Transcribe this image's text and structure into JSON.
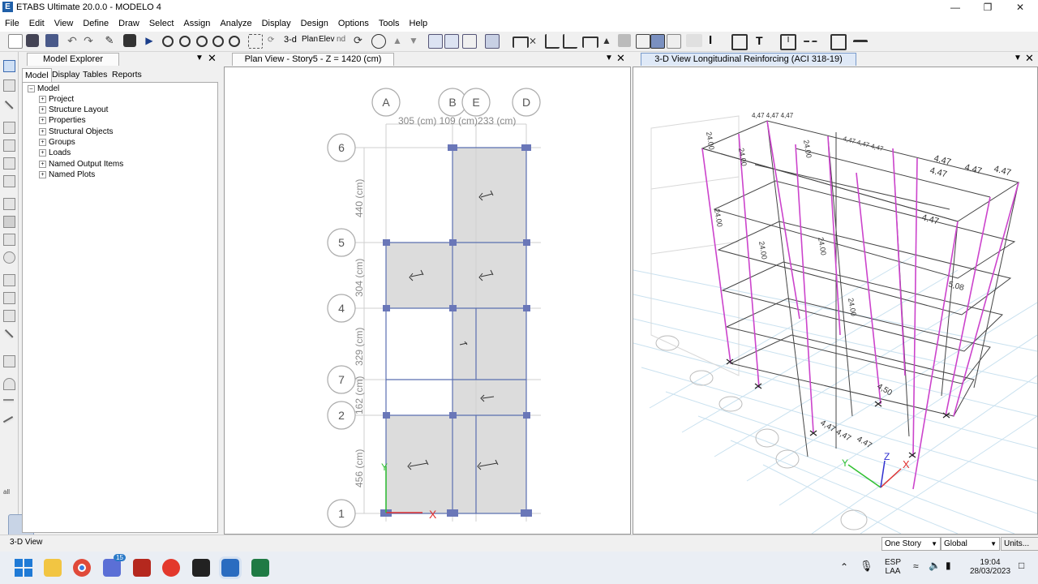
{
  "window": {
    "title": "ETABS Ultimate 20.0.0 - MODELO 4",
    "app_letter": "E"
  },
  "menu": [
    "File",
    "Edit",
    "View",
    "Define",
    "Draw",
    "Select",
    "Assign",
    "Analyze",
    "Display",
    "Design",
    "Options",
    "Tools",
    "Help"
  ],
  "toolbar": {
    "view_3d": "3-d",
    "plan": "Plan",
    "elevation": "Elev",
    "nd": "nd"
  },
  "model_explorer": {
    "title": "Model Explorer",
    "tabs": [
      "Model",
      "Display",
      "Tables",
      "Reports"
    ],
    "root": "Model",
    "items": [
      "Project",
      "Structure Layout",
      "Properties",
      "Structural Objects",
      "Groups",
      "Loads",
      "Named Output Items",
      "Named Plots"
    ]
  },
  "plan_view": {
    "title": "Plan View - Story5 - Z = 1420 (cm)",
    "grid_x": [
      "A",
      "B",
      "E",
      "D"
    ],
    "grid_y": [
      "6",
      "5",
      "4",
      "7",
      "2",
      "1"
    ],
    "dim_x": "305 (cm) 109 (cm)233 (cm)",
    "dim_y": [
      "440 (cm)",
      "304 (cm)",
      "329 (cm)",
      "162 (cm)",
      "456 (cm)"
    ],
    "axis_x": "X",
    "axis_y": "Y"
  },
  "view3d": {
    "title": "3-D View  Longitudinal Reinforcing  (ACI 318-19)",
    "rebar_label": "4.47",
    "column_label": "24.00",
    "beam_labels": [
      "4,47  4,47  4,47",
      "4,47 4,47 4,47",
      "4,47",
      "5,08",
      "4,50",
      "4,47 4,47"
    ],
    "axis_x": "X",
    "axis_y": "Y",
    "axis_z": "Z"
  },
  "status": {
    "left": "3-D View",
    "story": "One Story",
    "coord": "Global",
    "units": "Units..."
  },
  "taskbar": {
    "badge": "15",
    "lang": "ESP",
    "layout": "LAA",
    "time": "19:04",
    "date": "28/03/2023"
  },
  "colors": {
    "slab": "#dcdcdc",
    "grid_line": "#5a6fb0",
    "column": "#cc44cc",
    "node": "#6a77b8"
  }
}
